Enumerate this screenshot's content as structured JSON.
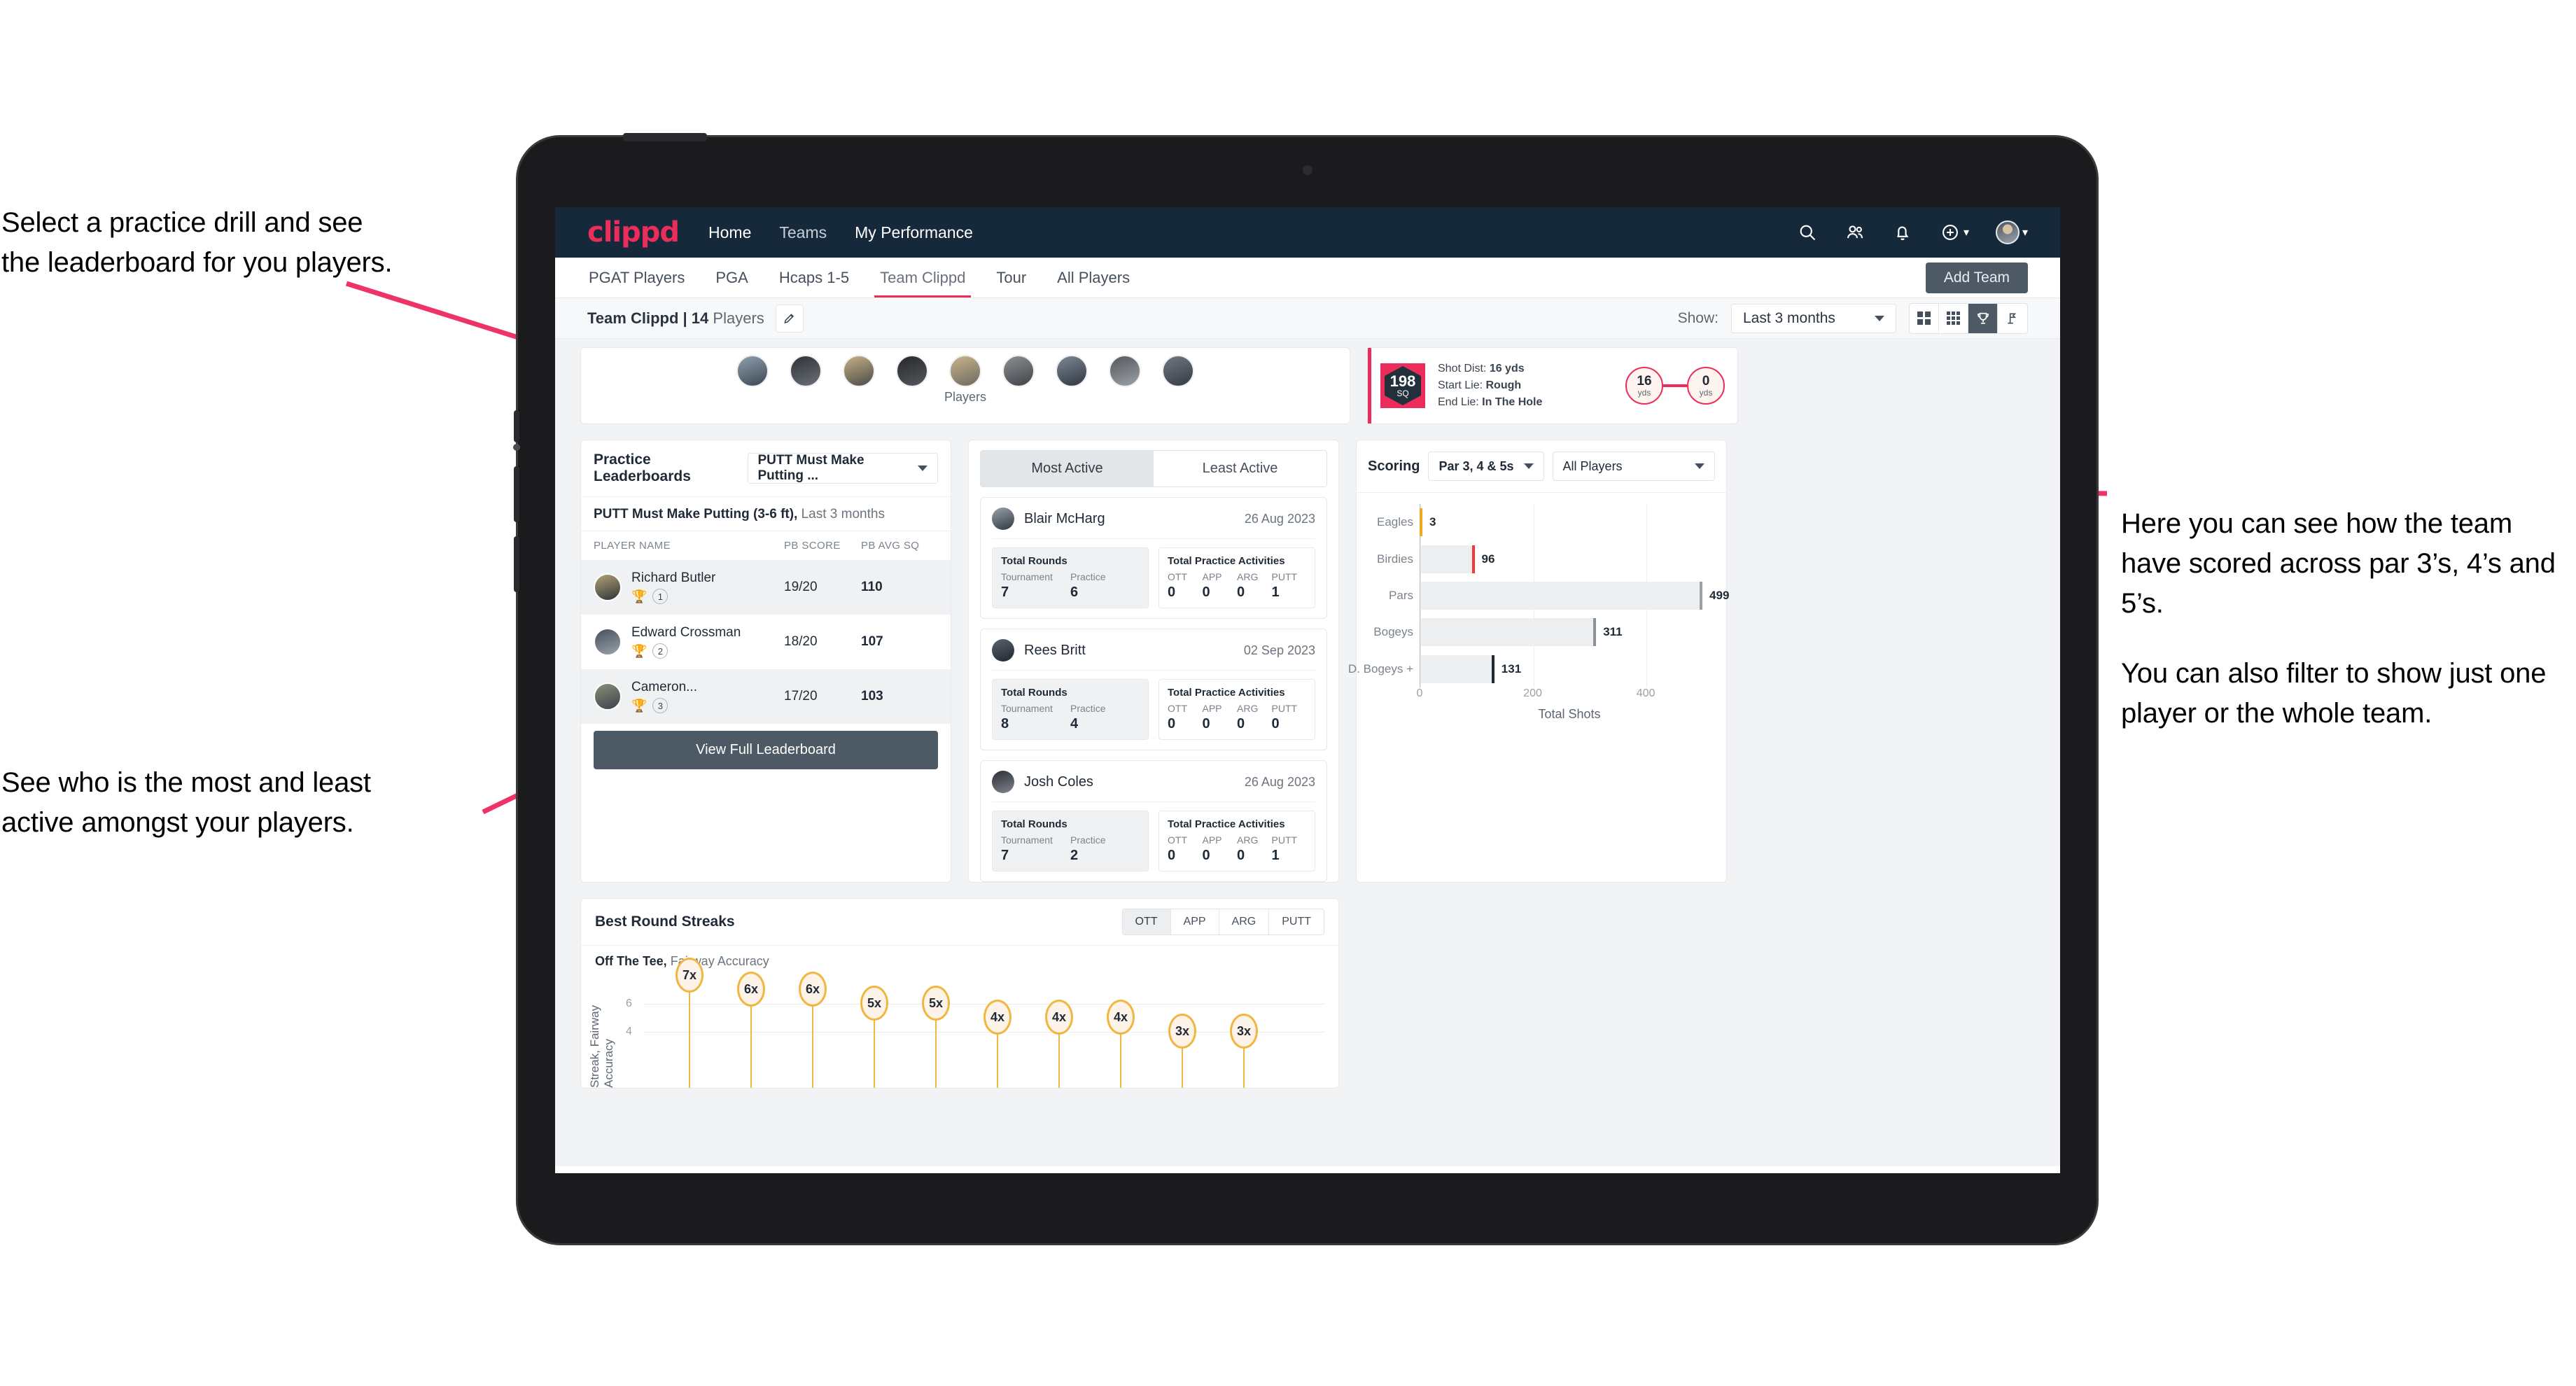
{
  "annotations": {
    "top_left": [
      "Select a practice drill and see",
      "the leaderboard for you players."
    ],
    "bottom_left": [
      "See who is the most and least",
      "active amongst your players."
    ],
    "right": [
      "Here you can see how the team have scored across par 3’s, 4’s and 5’s.",
      "You can also filter to show just one player or the whole team."
    ]
  },
  "brand": {
    "logo": "clippd",
    "accent": "#ec2c5a",
    "navbar_bg": "#16293b"
  },
  "topnav": {
    "links": [
      {
        "label": "Home",
        "active": true
      },
      {
        "label": "Teams",
        "active": false
      },
      {
        "label": "My Performance",
        "active": true
      }
    ],
    "icons": [
      "search-icon",
      "people-icon",
      "bell-icon",
      "plus-circle-icon",
      "avatar"
    ]
  },
  "tabs": [
    {
      "label": "PGAT Players",
      "active": false
    },
    {
      "label": "PGA",
      "active": false
    },
    {
      "label": "Hcaps 1-5",
      "active": false
    },
    {
      "label": "Team Clippd",
      "active": true
    },
    {
      "label": "Tour",
      "active": false
    },
    {
      "label": "All Players",
      "active": false
    }
  ],
  "add_team_button": "Add Team",
  "subheader": {
    "team_name": "Team Clippd",
    "separator": "|",
    "player_count": "14",
    "players_word": "Players",
    "show_label": "Show:",
    "period_value": "Last 3 months",
    "edit_icon": "pencil-icon",
    "view_modes": [
      "grid-view-icon",
      "dense-grid-icon",
      "trophy-icon",
      "flag-icon"
    ],
    "view_selected_index": 2
  },
  "players_strip": {
    "caption": "Players",
    "avatar_count": 9
  },
  "shot_card": {
    "badge_value": "198",
    "badge_unit": "SQ",
    "lines": [
      {
        "label": "Shot Dist:",
        "value": "16 yds"
      },
      {
        "label": "Start Lie:",
        "value": "Rough"
      },
      {
        "label": "End Lie:",
        "value": "In The Hole"
      }
    ],
    "start": {
      "value": "16",
      "unit": "yds"
    },
    "end": {
      "value": "0",
      "unit": "yds"
    }
  },
  "leaderboard": {
    "title": "Practice Leaderboards",
    "drill_select": "PUTT Must Make Putting ...",
    "subtitle_bold": "PUTT Must Make Putting (3-6 ft),",
    "subtitle_muted": " Last 3 months",
    "columns": [
      "PLAYER NAME",
      "PB SCORE",
      "PB AVG SQ"
    ],
    "rows": [
      {
        "name": "Richard Butler",
        "rank": "1",
        "medal": "gold",
        "pb_score": "19/20",
        "pb_avg_sq": "110"
      },
      {
        "name": "Edward Crossman",
        "rank": "2",
        "medal": "silver",
        "pb_score": "18/20",
        "pb_avg_sq": "107"
      },
      {
        "name": "Cameron...",
        "rank": "3",
        "medal": "bronze",
        "pb_score": "17/20",
        "pb_avg_sq": "103"
      }
    ],
    "button": "View Full Leaderboard"
  },
  "activity": {
    "tabs": [
      {
        "label": "Most Active",
        "active": true
      },
      {
        "label": "Least Active",
        "active": false
      }
    ],
    "cards": [
      {
        "player": "Blair McHarg",
        "date": "26 Aug 2023",
        "rounds_title": "Total Rounds",
        "rounds": [
          {
            "label": "Tournament",
            "value": "7"
          },
          {
            "label": "Practice",
            "value": "6"
          }
        ],
        "practice_title": "Total Practice Activities",
        "practice": [
          {
            "label": "OTT",
            "value": "0"
          },
          {
            "label": "APP",
            "value": "0"
          },
          {
            "label": "ARG",
            "value": "0"
          },
          {
            "label": "PUTT",
            "value": "1"
          }
        ]
      },
      {
        "player": "Rees Britt",
        "date": "02 Sep 2023",
        "rounds_title": "Total Rounds",
        "rounds": [
          {
            "label": "Tournament",
            "value": "8"
          },
          {
            "label": "Practice",
            "value": "4"
          }
        ],
        "practice_title": "Total Practice Activities",
        "practice": [
          {
            "label": "OTT",
            "value": "0"
          },
          {
            "label": "APP",
            "value": "0"
          },
          {
            "label": "ARG",
            "value": "0"
          },
          {
            "label": "PUTT",
            "value": "0"
          }
        ]
      },
      {
        "player": "Josh Coles",
        "date": "26 Aug 2023",
        "rounds_title": "Total Rounds",
        "rounds": [
          {
            "label": "Tournament",
            "value": "7"
          },
          {
            "label": "Practice",
            "value": "2"
          }
        ],
        "practice_title": "Total Practice Activities",
        "practice": [
          {
            "label": "OTT",
            "value": "0"
          },
          {
            "label": "APP",
            "value": "0"
          },
          {
            "label": "ARG",
            "value": "0"
          },
          {
            "label": "PUTT",
            "value": "1"
          }
        ]
      }
    ]
  },
  "scoring": {
    "title": "Scoring",
    "par_select": "Par 3, 4 & 5s",
    "player_select": "All Players"
  },
  "streaks": {
    "title": "Best Round Streaks",
    "tabs": [
      {
        "label": "OTT",
        "active": true
      },
      {
        "label": "APP",
        "active": false
      },
      {
        "label": "ARG",
        "active": false
      },
      {
        "label": "PUTT",
        "active": false
      }
    ],
    "subtitle_bold": "Off The Tee,",
    "subtitle_muted": " Fairway Accuracy"
  },
  "chart_data": [
    {
      "type": "bar",
      "orientation": "horizontal",
      "title": "Scoring",
      "categories": [
        "Eagles",
        "Birdies",
        "Pars",
        "Bogeys",
        "D. Bogeys +"
      ],
      "values": [
        3,
        96,
        499,
        311,
        131
      ],
      "cap_colors": [
        "#f0a81e",
        "#ee3b3b",
        "#9aa0a6",
        "#8b9199",
        "#1f2a36"
      ],
      "xlabel": "Total Shots",
      "ylabel": "",
      "xlim": [
        0,
        520
      ],
      "xticks": [
        0,
        200,
        400
      ],
      "grid": true,
      "legend": "none"
    },
    {
      "type": "bar",
      "orientation": "vertical",
      "title": "Best Round Streaks — Off The Tee, Fairway Accuracy",
      "ylabel": "Streak, Fairway Accuracy",
      "yticks": [
        4,
        6
      ],
      "ylim": [
        0,
        8
      ],
      "labels": [
        "7x",
        "6x",
        "6x",
        "5x",
        "5x",
        "4x",
        "4x",
        "4x",
        "3x",
        "3x"
      ],
      "values": [
        7,
        6,
        6,
        5,
        5,
        4,
        4,
        4,
        3,
        3
      ],
      "marker_color": "#f0b63f",
      "grid": true
    }
  ]
}
